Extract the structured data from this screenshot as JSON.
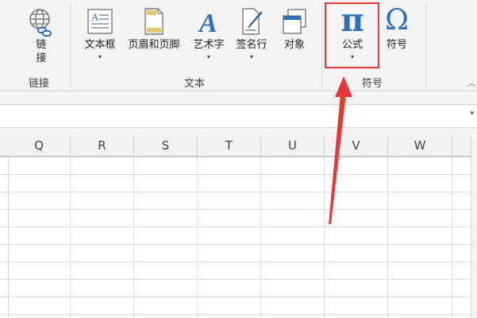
{
  "ribbon": {
    "link_group": {
      "link_button": {
        "line1": "链",
        "line2": "接"
      },
      "label": "链接"
    },
    "text_group": {
      "textbox": "文本框",
      "header_footer": "页眉和页脚",
      "wordart": "艺术字",
      "signature_line": "签名行",
      "object": "对象",
      "label": "文本"
    },
    "symbol_group": {
      "equation": "公式",
      "symbol": "符号",
      "label": "符号",
      "pi_glyph": "π",
      "omega_glyph": "Ω"
    },
    "caret_glyph": "▾",
    "scroll_glyph": "︿"
  },
  "columns": [
    "Q",
    "R",
    "S",
    "T",
    "U",
    "V",
    "W"
  ],
  "colors": {
    "highlight": "#e53935",
    "arrow": "#e53935",
    "symbol_blue": "#2e6fb8"
  }
}
